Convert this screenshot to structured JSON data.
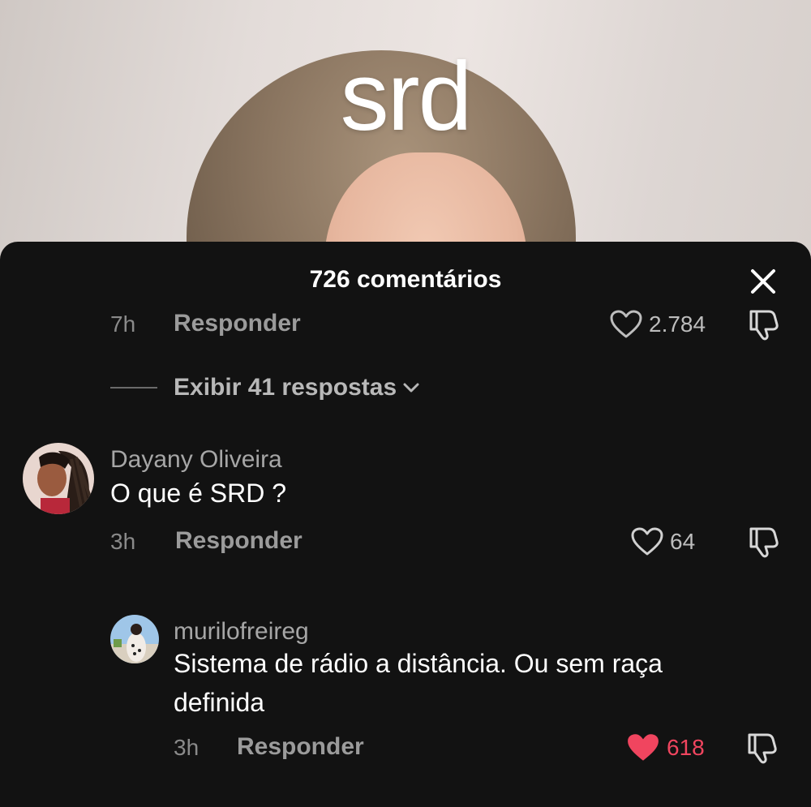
{
  "video": {
    "overlay_text": "srd"
  },
  "comments_sheet": {
    "title": "726 comentários",
    "close_icon": "close-icon",
    "previous_comment": {
      "time": "7h",
      "reply_label": "Responder",
      "likes": "2.784"
    },
    "view_replies_label": "Exibir 41 respostas",
    "comments": [
      {
        "username": "Dayany Oliveira",
        "text": "O que é SRD ?",
        "time": "3h",
        "reply_label": "Responder",
        "likes": "64",
        "liked": false
      }
    ],
    "replies": [
      {
        "username": "murilofreireg",
        "text": "Sistema de rádio a distância. Ou sem raça definida",
        "time": "3h",
        "reply_label": "Responder",
        "likes": "618",
        "liked": true
      }
    ]
  },
  "colors": {
    "sheet_background": "#121212",
    "liked_heart": "#f0455f",
    "secondary_text": "#9b9b9b"
  }
}
